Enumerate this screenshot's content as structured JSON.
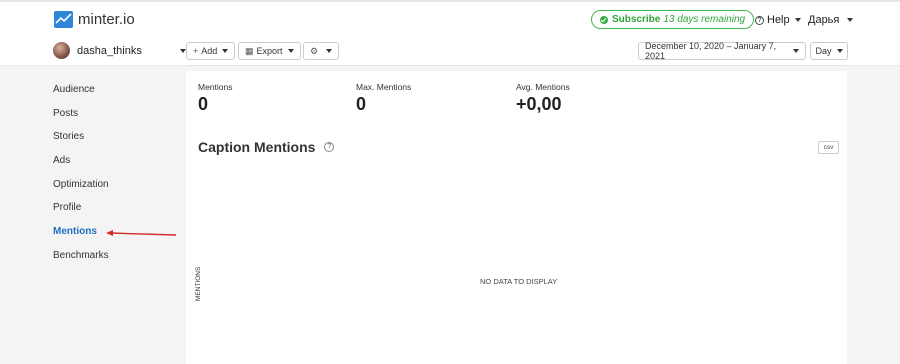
{
  "header": {
    "brand": "minter.io",
    "subscribe_label": "Subscribe",
    "subscribe_note": "13 days remaining",
    "help_label": "Help",
    "user_label": "Дарья"
  },
  "toolbar": {
    "account_name": "dasha_thinks",
    "add_label": "Add",
    "export_label": "Export",
    "date_range": "December 10, 2020 – January 7, 2021",
    "interval": "Day"
  },
  "sidebar": {
    "items": [
      {
        "label": "Audience"
      },
      {
        "label": "Posts"
      },
      {
        "label": "Stories"
      },
      {
        "label": "Ads"
      },
      {
        "label": "Optimization"
      },
      {
        "label": "Profile"
      },
      {
        "label": "Mentions",
        "active": true
      },
      {
        "label": "Benchmarks"
      }
    ]
  },
  "stats": [
    {
      "label": "Mentions",
      "value": "0"
    },
    {
      "label": "Max. Mentions",
      "value": "0"
    },
    {
      "label": "Avg. Mentions",
      "value": "+0,00"
    }
  ],
  "chart": {
    "title": "Caption Mentions",
    "csv_label": "csv",
    "y_axis_label": "MENTIONS",
    "empty_message": "NO DATA TO DISPLAY"
  },
  "colors": {
    "brand": "#2f86d6",
    "active_nav": "#1f6fbf",
    "subscribe": "#34b043",
    "annotation_arrow": "#d42a2a"
  }
}
